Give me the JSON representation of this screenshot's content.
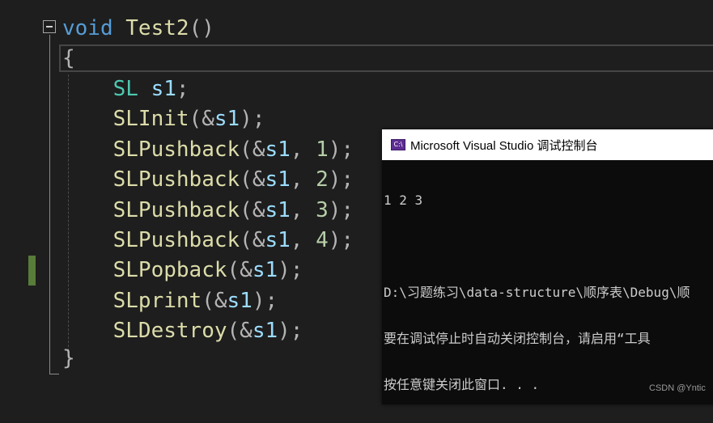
{
  "editor": {
    "lines": [
      {
        "segments": [
          {
            "t": "void",
            "c": "kw"
          },
          {
            "t": " ",
            "c": ""
          },
          {
            "t": "Test2",
            "c": "fn"
          },
          {
            "t": "()",
            "c": "punc"
          }
        ]
      },
      {
        "segments": [
          {
            "t": "{",
            "c": "punc"
          }
        ]
      },
      {
        "segments": [
          {
            "t": "    ",
            "c": ""
          },
          {
            "t": "SL",
            "c": "ty"
          },
          {
            "t": " ",
            "c": ""
          },
          {
            "t": "s1",
            "c": "var"
          },
          {
            "t": ";",
            "c": "punc"
          }
        ]
      },
      {
        "segments": [
          {
            "t": "    ",
            "c": ""
          },
          {
            "t": "SLInit",
            "c": "fn"
          },
          {
            "t": "(&",
            "c": "punc"
          },
          {
            "t": "s1",
            "c": "var"
          },
          {
            "t": ");",
            "c": "punc"
          }
        ]
      },
      {
        "segments": [
          {
            "t": "    ",
            "c": ""
          },
          {
            "t": "SLPushback",
            "c": "fn"
          },
          {
            "t": "(&",
            "c": "punc"
          },
          {
            "t": "s1",
            "c": "var"
          },
          {
            "t": ", ",
            "c": "punc"
          },
          {
            "t": "1",
            "c": "num"
          },
          {
            "t": ");",
            "c": "punc"
          }
        ]
      },
      {
        "segments": [
          {
            "t": "    ",
            "c": ""
          },
          {
            "t": "SLPushback",
            "c": "fn"
          },
          {
            "t": "(&",
            "c": "punc"
          },
          {
            "t": "s1",
            "c": "var"
          },
          {
            "t": ", ",
            "c": "punc"
          },
          {
            "t": "2",
            "c": "num"
          },
          {
            "t": ");",
            "c": "punc"
          }
        ]
      },
      {
        "segments": [
          {
            "t": "    ",
            "c": ""
          },
          {
            "t": "SLPushback",
            "c": "fn"
          },
          {
            "t": "(&",
            "c": "punc"
          },
          {
            "t": "s1",
            "c": "var"
          },
          {
            "t": ", ",
            "c": "punc"
          },
          {
            "t": "3",
            "c": "num"
          },
          {
            "t": ");",
            "c": "punc"
          }
        ]
      },
      {
        "segments": [
          {
            "t": "    ",
            "c": ""
          },
          {
            "t": "SLPushback",
            "c": "fn"
          },
          {
            "t": "(&",
            "c": "punc"
          },
          {
            "t": "s1",
            "c": "var"
          },
          {
            "t": ", ",
            "c": "punc"
          },
          {
            "t": "4",
            "c": "num"
          },
          {
            "t": ");",
            "c": "punc"
          }
        ]
      },
      {
        "segments": [
          {
            "t": "    ",
            "c": ""
          },
          {
            "t": "SLPopback",
            "c": "fn"
          },
          {
            "t": "(&",
            "c": "punc"
          },
          {
            "t": "s1",
            "c": "var"
          },
          {
            "t": ");",
            "c": "punc"
          }
        ]
      },
      {
        "segments": [
          {
            "t": "    ",
            "c": ""
          },
          {
            "t": "SLprint",
            "c": "fn"
          },
          {
            "t": "(&",
            "c": "punc"
          },
          {
            "t": "s1",
            "c": "var"
          },
          {
            "t": ");",
            "c": "punc"
          }
        ]
      },
      {
        "segments": [
          {
            "t": "    ",
            "c": ""
          },
          {
            "t": "SLDestroy",
            "c": "fn"
          },
          {
            "t": "(&",
            "c": "punc"
          },
          {
            "t": "s1",
            "c": "var"
          },
          {
            "t": ");",
            "c": "punc"
          }
        ]
      },
      {
        "segments": [
          {
            "t": "}",
            "c": "punc"
          }
        ]
      }
    ]
  },
  "console": {
    "title": "Microsoft Visual Studio 调试控制台",
    "icon": "visual-studio-icon",
    "icon_glyph": "C:\\",
    "output_lines": [
      "1 2 3",
      "",
      "D:\\习题练习\\data-structure\\顺序表\\Debug\\顺",
      "要在调试停止时自动关闭控制台，请启用“工具",
      "按任意键关闭此窗口. . ."
    ]
  },
  "watermark": "CSDN @Yntic",
  "colors": {
    "editor_bg": "#1e1e1e",
    "keyword": "#569cd6",
    "function": "#dcdcaa",
    "type": "#4ec9b0",
    "variable": "#9cdcfe",
    "number": "#b5cea8",
    "change_marker": "#587c3a",
    "console_bg": "#0c0c0c"
  }
}
